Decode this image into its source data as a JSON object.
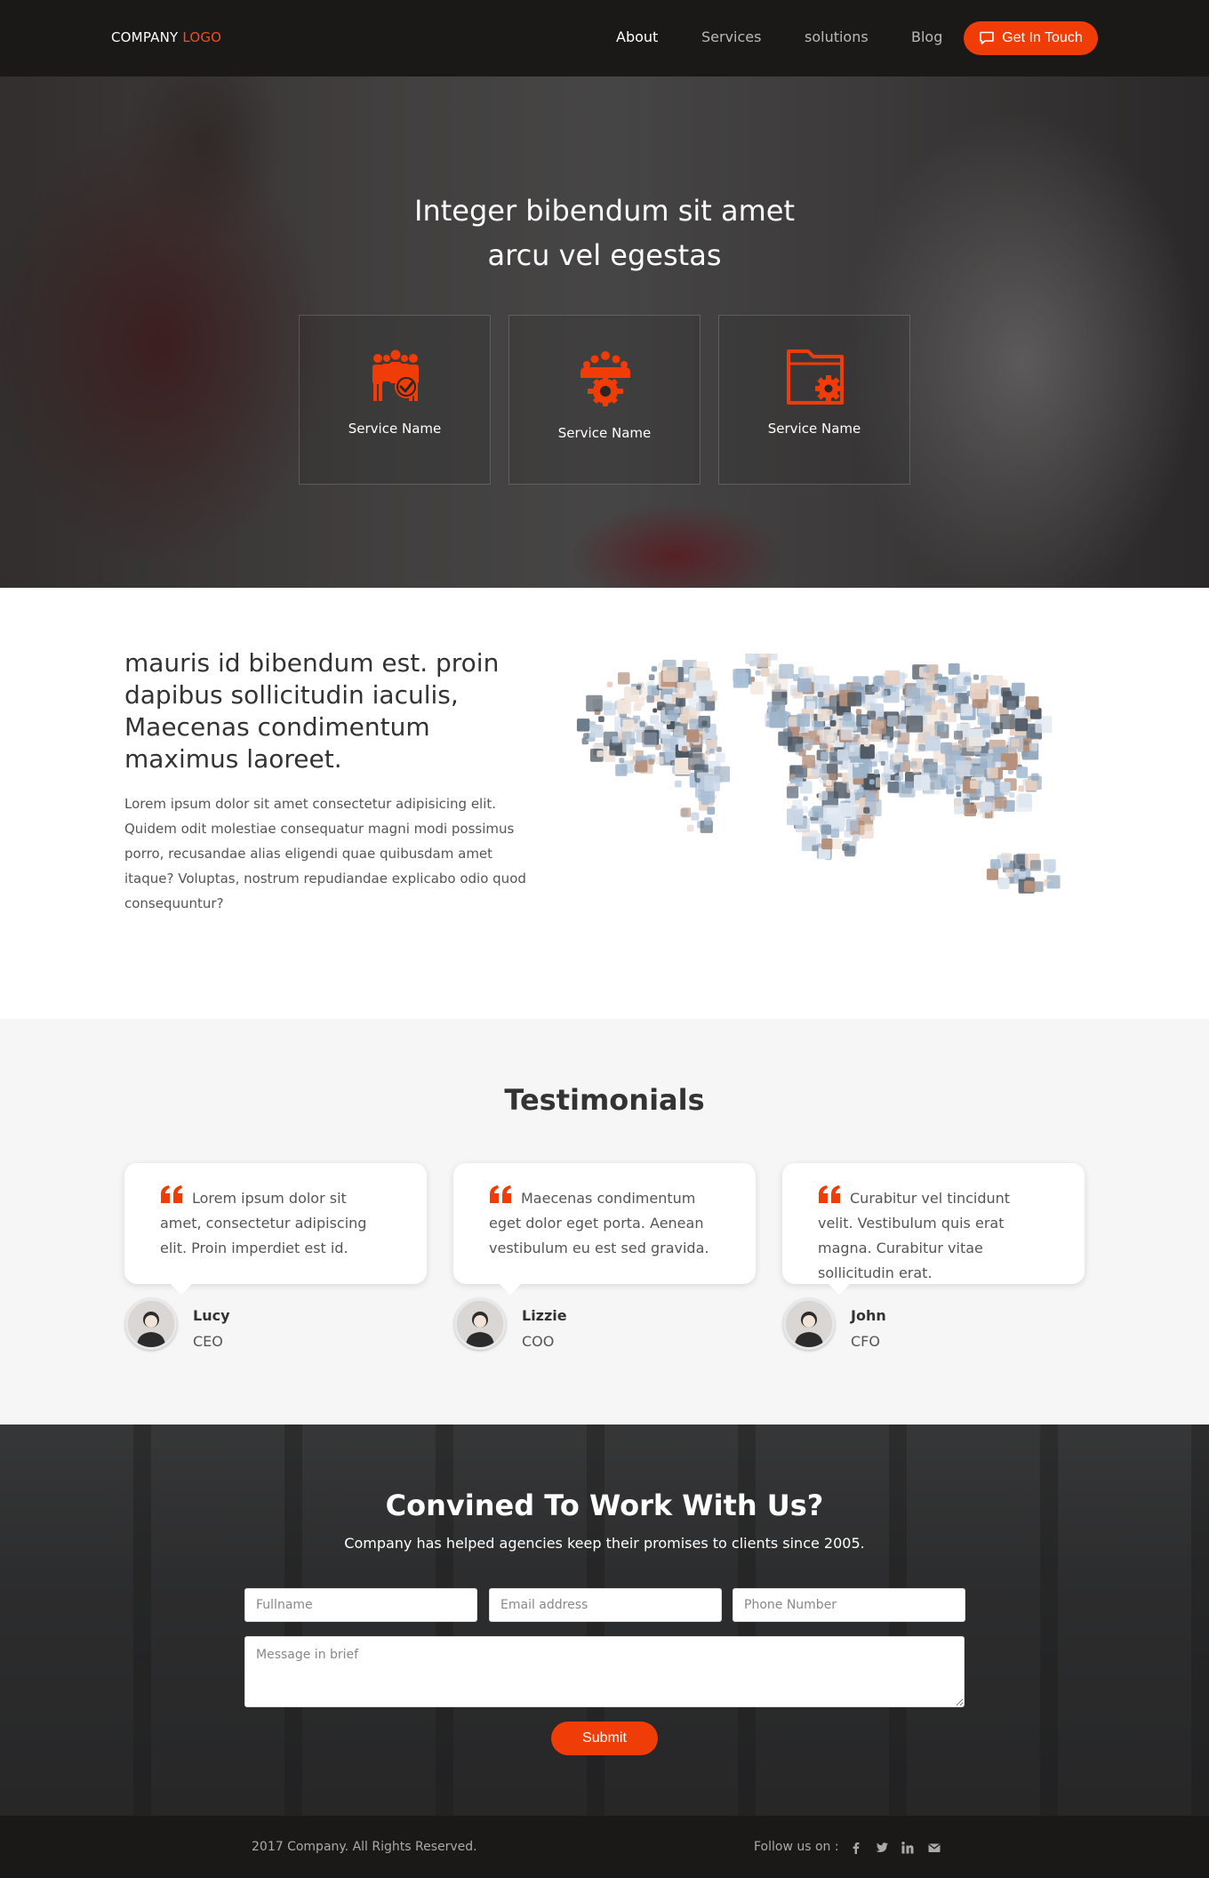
{
  "nav": {
    "logo_main": "COMPANY",
    "logo_accent": "LOGO",
    "links": [
      "About",
      "Services",
      "solutions",
      "Blog"
    ],
    "cta_label": "Get In Touch"
  },
  "hero": {
    "title_line1": "Integer bibendum sit amet",
    "title_line2": "arcu vel egestas",
    "services": [
      {
        "label": "Service Name",
        "icon": "team-check-icon"
      },
      {
        "label": "Service Name",
        "icon": "team-gear-icon"
      },
      {
        "label": "Service Name",
        "icon": "folder-gear-icon"
      }
    ]
  },
  "about": {
    "title": "mauris id bibendum est. proin dapibus sollicitudin iaculis, Maecenas condimentum maximus laoreet.",
    "text": "Lorem ipsum dolor sit amet consectetur adipisicing elit. Quidem odit molestiae consequatur magni modi possimus porro, recusandae alias eligendi quae quibusdam amet itaque? Voluptas, nostrum repudiandae explicabo odio quod consequuntur?"
  },
  "testimonials": {
    "heading": "Testimonials",
    "items": [
      {
        "quote": "Lorem ipsum dolor sit amet, consectetur adipiscing elit. Proin imperdiet est id.",
        "name": "Lucy",
        "role": "CEO"
      },
      {
        "quote": "Maecenas condimentum eget dolor eget porta. Aenean vestibulum eu est sed gravida.",
        "name": "Lizzie",
        "role": "COO"
      },
      {
        "quote": "Curabitur vel tincidunt velit. Vestibulum quis erat magna. Curabitur vitae sollicitudin erat.",
        "name": "John",
        "role": "CFO"
      }
    ]
  },
  "contact": {
    "title": "Convined To Work With Us?",
    "subtitle": "Company has helped agencies keep their promises to clients since 2005.",
    "fullname_placeholder": "Fullname",
    "email_placeholder": "Email address",
    "phone_placeholder": "Phone Number",
    "message_placeholder": "Message in brief",
    "submit_label": "Submit"
  },
  "footer": {
    "copyright": "2017 Company. All Rights Reserved.",
    "follow_label": "Follow us on :",
    "social": [
      "facebook-icon",
      "twitter-icon",
      "linkedin-icon",
      "envelope-icon"
    ]
  },
  "colors": {
    "accent": "#f03c06",
    "nav_bg": "#1b1918",
    "testimonials_bg": "#f6f6f6"
  }
}
